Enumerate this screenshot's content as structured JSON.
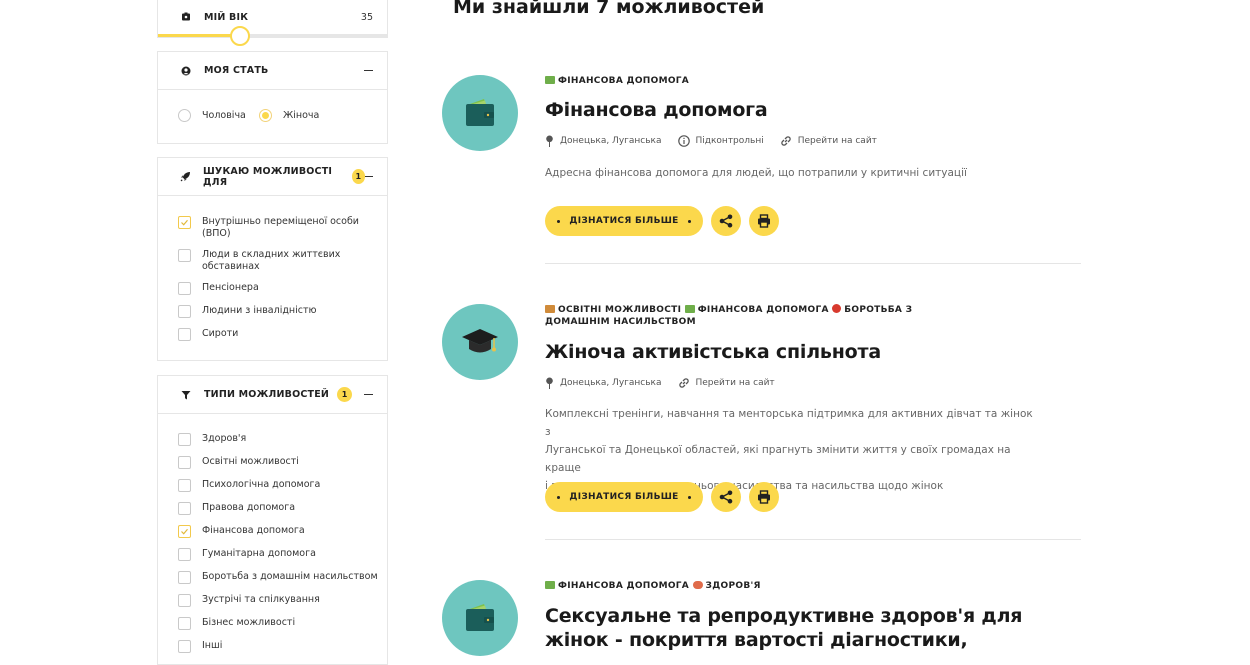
{
  "filters": {
    "age": {
      "label": "МІЙ ВІК",
      "value": "35",
      "slider_fraction": 0.36
    },
    "gender": {
      "label": "МОЯ СТАТЬ",
      "options": [
        {
          "label": "Чоловіча",
          "selected": false
        },
        {
          "label": "Жіноча",
          "selected": true
        }
      ]
    },
    "target_groups": {
      "label": "ШУКАЮ МОЖЛИВОСТІ ДЛЯ",
      "count": "1",
      "options": [
        {
          "label": "Внутрішньо переміщеної особи (ВПО)",
          "checked": true
        },
        {
          "label": "Люди в складних життєвих обставинах",
          "checked": false
        },
        {
          "label": "Пенсіонера",
          "checked": false
        },
        {
          "label": "Людини з інвалідністю",
          "checked": false
        },
        {
          "label": "Сироти",
          "checked": false
        }
      ]
    },
    "types": {
      "label": "ТИПИ МОЖЛИВОСТЕЙ",
      "count": "1",
      "options": [
        {
          "label": "Здоров'я",
          "checked": false
        },
        {
          "label": "Освітні можливості",
          "checked": false
        },
        {
          "label": "Психологічна допомога",
          "checked": false
        },
        {
          "label": "Правова допомога",
          "checked": false
        },
        {
          "label": "Фінансова допомога",
          "checked": true
        },
        {
          "label": "Гуманітарна допомога",
          "checked": false
        },
        {
          "label": "Боротьба з домашнім насильством",
          "checked": false
        },
        {
          "label": "Зустрічі та спілкування",
          "checked": false
        },
        {
          "label": "Бізнес можливості",
          "checked": false
        },
        {
          "label": "Інші",
          "checked": false
        }
      ]
    }
  },
  "results": {
    "heading": "Ми знайшли 7 можливостей",
    "items": [
      {
        "tags": [
          "ФІНАНСОВА ДОПОМОГА"
        ],
        "title": "Фінансова допомога",
        "location": "Донецька, Луганська",
        "control": "Підконтрольні",
        "site_link": "Перейти на сайт",
        "description": "Адресна фінансова допомога для людей, що потрапили у критичні ситуації",
        "more_label": "ДІЗНАТИСЯ БІЛЬШЕ",
        "icon": "wallet-icon"
      },
      {
        "tags": [
          "ОСВІТНІ МОЖЛИВОСТІ",
          "ФІНАНСОВА ДОПОМОГА",
          "БОРОТЬБА З ДОМАШНІМ НАСИЛЬСТВОМ"
        ],
        "title": "Жіноча активістська спільнота",
        "location": "Донецька, Луганська",
        "site_link": "Перейти на сайт",
        "description_lines": [
          "Комплексні тренінги, навчання та менторська підтримка для активних дівчат та жінок з",
          "Луганської та Донецької областей, які прагнуть змінити життя у своїх громадах на краще",
          "і виступають проти домашнього насильства та насильства щодо жінок"
        ],
        "more_label": "ДІЗНАТИСЯ БІЛЬШЕ",
        "icon": "graduation-cap-icon"
      },
      {
        "tags": [
          "ФІНАНСОВА ДОПОМОГА",
          "ЗДОРОВ'Я"
        ],
        "title_lines": [
          "Сексуальне та репродуктивне здоров'я для",
          "жінок - покриття вартості діагностики,"
        ],
        "icon": "wallet-icon"
      }
    ]
  },
  "colors": {
    "accent": "#fbd84c",
    "teal": "#6ec6bf",
    "wallet": "#1b5e5a"
  }
}
